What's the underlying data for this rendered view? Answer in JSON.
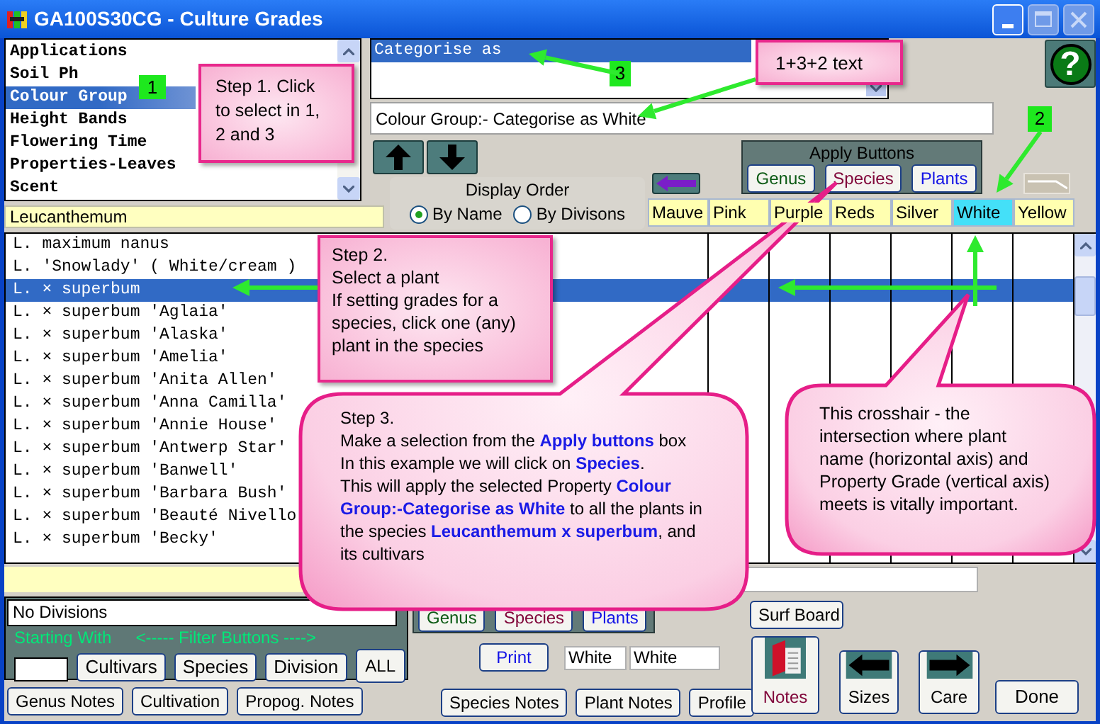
{
  "window": {
    "title": "GA100S30CG - Culture Grades"
  },
  "properties": [
    {
      "label": "Applications",
      "selected": false
    },
    {
      "label": "Soil Ph",
      "selected": false
    },
    {
      "label": "Colour Group",
      "selected": true
    },
    {
      "label": "Height Bands",
      "selected": false
    },
    {
      "label": "Flowering Time",
      "selected": false
    },
    {
      "label": "Properties-Leaves",
      "selected": false
    },
    {
      "label": "Scent",
      "selected": false
    }
  ],
  "genus_field": {
    "value": "Leucanthemum"
  },
  "categorise_options": [
    {
      "label": "Categorise as",
      "selected": true
    }
  ],
  "grade_text": {
    "value": "Colour Group:- Categorise as White"
  },
  "help_button": {
    "label": "?"
  },
  "display_order": {
    "title": "Display Order",
    "options": [
      {
        "label": "By Name",
        "selected": true
      },
      {
        "label": "By Divisons",
        "selected": false
      }
    ]
  },
  "apply_panel": {
    "title": "Apply Buttons",
    "buttons": [
      {
        "label": "Genus",
        "color": "#0b5a14"
      },
      {
        "label": "Species",
        "color": "#80063a"
      },
      {
        "label": "Plants",
        "color": "#1212e6"
      }
    ]
  },
  "grade_columns": [
    {
      "label": "Mauve",
      "selected": false
    },
    {
      "label": "Pink",
      "selected": false
    },
    {
      "label": "Purple",
      "selected": false
    },
    {
      "label": "Reds",
      "selected": false
    },
    {
      "label": "Silver",
      "selected": false
    },
    {
      "label": "White",
      "selected": true
    },
    {
      "label": "Yellow",
      "selected": false
    }
  ],
  "plants": [
    {
      "name": "L. maximum nanus",
      "selected": false
    },
    {
      "name": "L. 'Snowlady' ( White/cream )",
      "selected": false
    },
    {
      "name": "L. × superbum",
      "selected": true
    },
    {
      "name": "L. × superbum 'Aglaia'",
      "selected": false
    },
    {
      "name": "L. × superbum 'Alaska'",
      "selected": false
    },
    {
      "name": "L. × superbum 'Amelia'",
      "selected": false
    },
    {
      "name": "L. × superbum 'Anita Allen'",
      "selected": false
    },
    {
      "name": "L. × superbum 'Anna Camilla'",
      "selected": false
    },
    {
      "name": "L. × superbum 'Annie House'",
      "selected": false
    },
    {
      "name": "L. × superbum 'Antwerp Star'",
      "selected": false
    },
    {
      "name": "L. × superbum 'Banwell'",
      "selected": false
    },
    {
      "name": "L. × superbum 'Barbara Bush'",
      "selected": false
    },
    {
      "name": "L. × superbum 'Beauté Nivello",
      "selected": false
    },
    {
      "name": "L. × superbum 'Becky'",
      "selected": false
    }
  ],
  "division_select": {
    "value": "No Divisions"
  },
  "filter_panel": {
    "starting_with": "Starting With",
    "filter_label": "<----- Filter Buttons ---->",
    "buttons": [
      "Cultivars",
      "Species",
      "Division"
    ],
    "all_button": "ALL"
  },
  "apply_panel_2": {
    "buttons": [
      {
        "label": "Genus",
        "color": "#0b5a14"
      },
      {
        "label": "Species",
        "color": "#80063a"
      },
      {
        "label": "Plants",
        "color": "#1212e6"
      }
    ]
  },
  "print_button": {
    "label": "Print"
  },
  "grade_fields": [
    "White",
    "White"
  ],
  "surf_board_button": {
    "label": "Surf Board"
  },
  "tool_buttons": [
    {
      "label": "Notes",
      "kind": "book"
    },
    {
      "label": "Sizes",
      "kind": "back"
    },
    {
      "label": "Care",
      "kind": "forward"
    }
  ],
  "done_button": {
    "label": "Done"
  },
  "notes_buttons": [
    "Genus Notes",
    "Cultivation",
    "Propog. Notes"
  ],
  "notes_buttons_2": [
    "Species Notes",
    "Plant Notes",
    "Profile"
  ],
  "annotations": {
    "badges": [
      "1",
      "3",
      "2"
    ],
    "step_1": "Step 1. Click to select in 1, 2 and 3",
    "text_note": "1+3+2 text",
    "step_2": [
      "Step 2.",
      "Select a plant",
      "If setting grades for a species, click one (any) plant in the species"
    ],
    "step_3": [
      "Step 3.",
      "Make a selection from the **Apply buttons** box",
      "In this example we will click on **Species**.",
      "This will apply the selected Property **Colour Group:-Categorise as White** to all the plants in the species **Leucanthemum x superbum**, and its cultivars"
    ],
    "crosshair_note": "This crosshair - the intersection where plant name (horizontal axis) and Property Grade (vertical axis) meets is vitally important."
  }
}
